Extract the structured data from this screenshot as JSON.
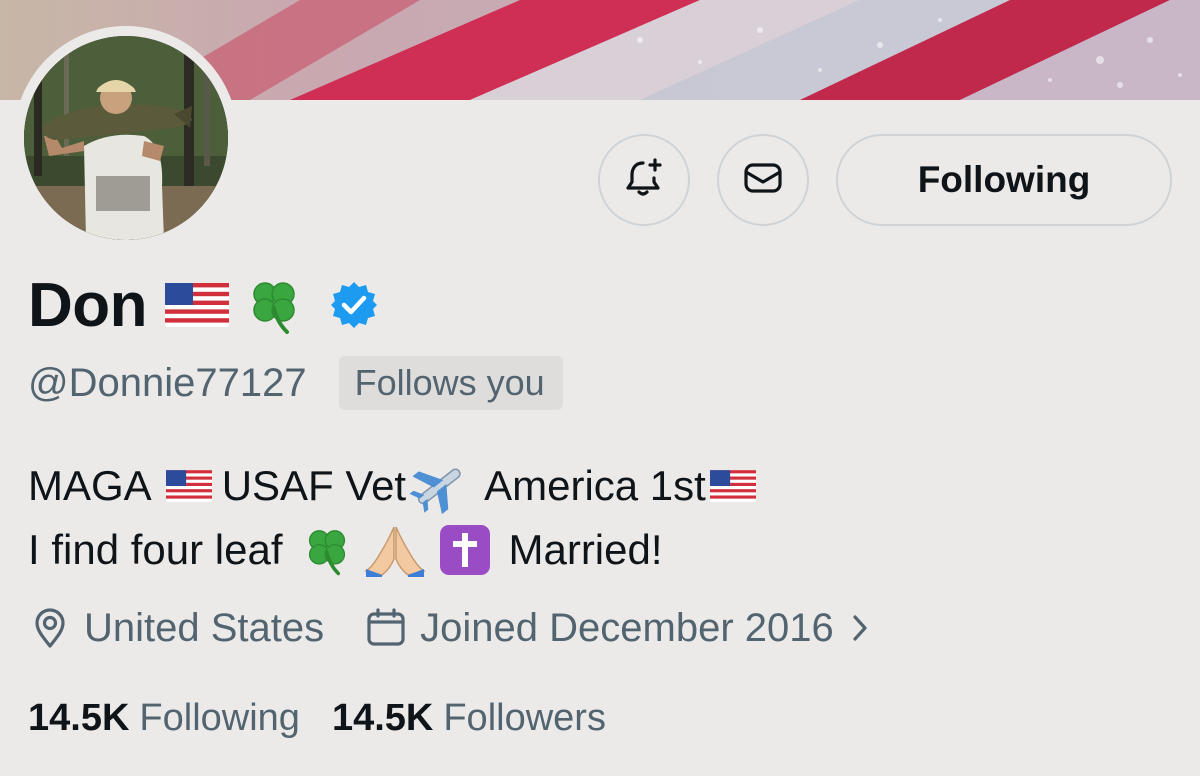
{
  "colors": {
    "background": "#eceae9",
    "text_primary": "#0f1419",
    "text_secondary": "#536471",
    "verified_blue": "#1d9bf0",
    "button_border": "#cfd3d6"
  },
  "profile": {
    "display_name": "Don",
    "name_emojis": [
      "us-flag-emoji",
      "four-leaf-clover-emoji"
    ],
    "verified": true,
    "handle": "@Donnie77127",
    "follows_you_label": "Follows you"
  },
  "actions": {
    "notify_icon": "bell-plus-icon",
    "message_icon": "envelope-icon",
    "follow_label": "Following"
  },
  "bio": {
    "line1": {
      "part1": "MAGA",
      "part2": "USAF Vet",
      "part3": "America 1st"
    },
    "line2": {
      "part1": "I find four leaf",
      "part2": "Married!"
    }
  },
  "meta": {
    "location_icon": "location-pin-icon",
    "location": "United States",
    "joined_icon": "calendar-icon",
    "joined": "Joined December 2016"
  },
  "stats": {
    "following_count": "14.5K",
    "following_label": "Following",
    "followers_count": "14.5K",
    "followers_label": "Followers"
  }
}
